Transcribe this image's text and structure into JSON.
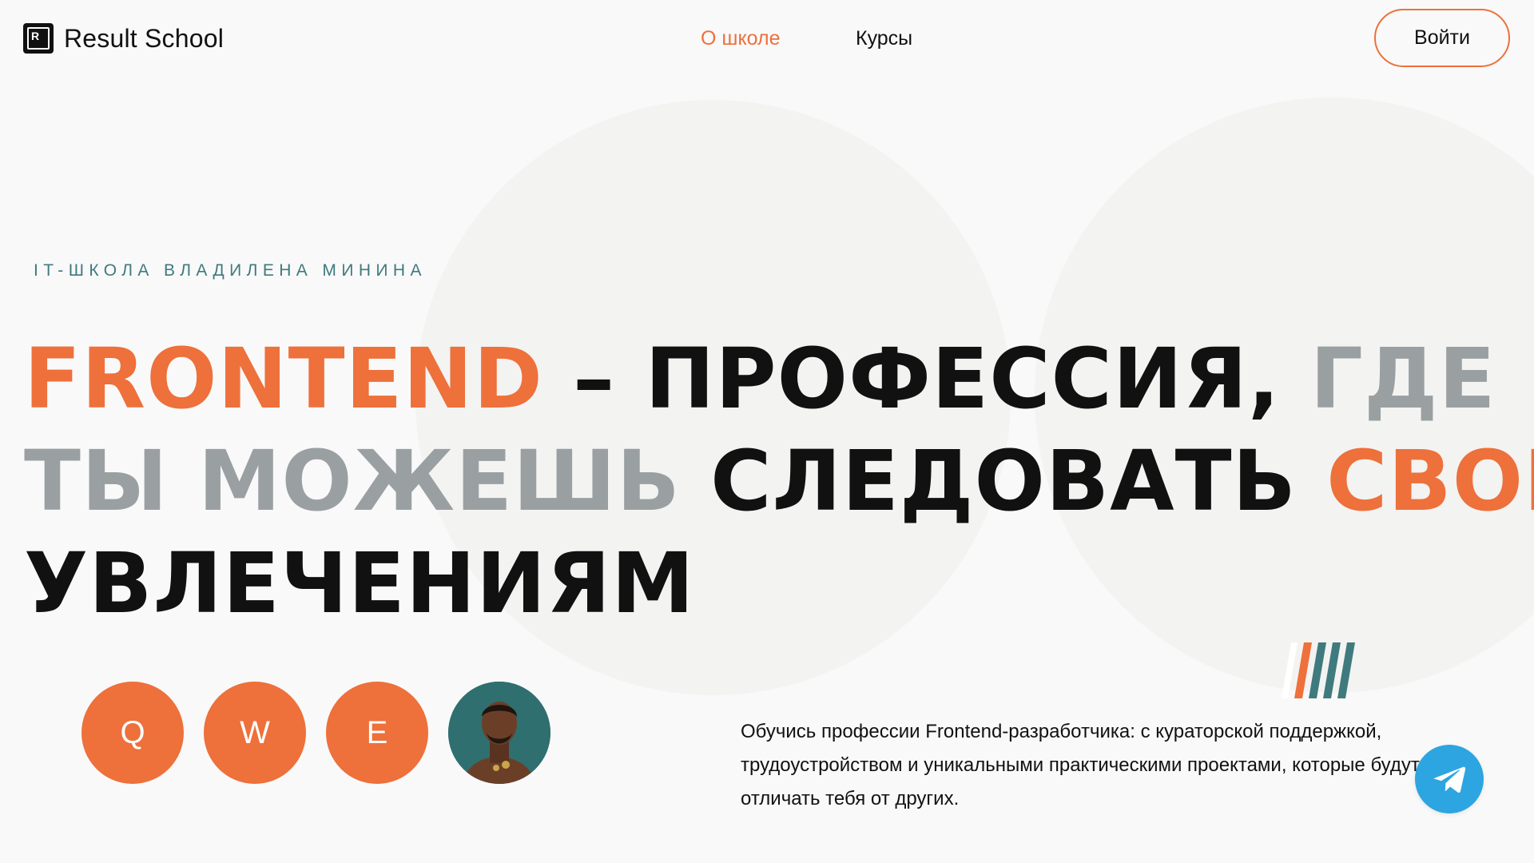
{
  "header": {
    "logo_text": "Result School",
    "logo_letter": "R",
    "nav": {
      "about": "О школе",
      "courses": "Курсы"
    },
    "login_label": "Войти"
  },
  "hero": {
    "eyebrow": "IT-ШКОЛА ВЛАДИЛЕНА МИНИНА",
    "headline": {
      "l1_a": "FRONTEND",
      "l1_b": " – ПРОФЕССИЯ, ",
      "l1_c": "ГДЕ",
      "l2_a": "ТЫ МОЖЕШЬ ",
      "l2_b": "СЛЕДОВАТЬ ",
      "l2_c": "СВОИМ",
      "l3": "УВЛЕЧЕНИЯМ"
    },
    "avatars": [
      "Q",
      "W",
      "E"
    ],
    "description": "Обучись профессии Frontend-разработчика: с кураторской поддержкой, трудоустройством и уникальными практическими проектами, которые будут отличать тебя от других."
  },
  "colors": {
    "accent": "#ee703b",
    "muted": "#9aa0a2",
    "eyebrow": "#3f7a7e",
    "telegram": "#2ca5e0"
  },
  "icons": {
    "logo": "result-school-logo-icon",
    "telegram": "telegram-icon",
    "decoration": "stripes-decoration"
  }
}
